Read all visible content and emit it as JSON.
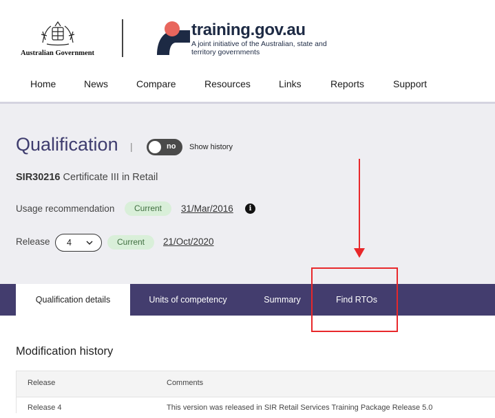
{
  "header": {
    "gov_logo_text": "Australian Government",
    "site_title": "training.gov.au",
    "site_subtitle": "A joint initiative of the Australian, state and territory governments"
  },
  "nav": {
    "items": [
      "Home",
      "News",
      "Compare",
      "Resources",
      "Links",
      "Reports",
      "Support"
    ]
  },
  "qualification": {
    "heading": "Qualification",
    "separator": "|",
    "toggle_label": "no",
    "show_history_label": "Show history",
    "code": "SIR30216",
    "name": "Certificate III in Retail",
    "usage_label": "Usage recommendation",
    "usage_status": "Current",
    "usage_date": "31/Mar/2016",
    "release_label": "Release",
    "release_value": "4",
    "release_status": "Current",
    "release_date": "21/Oct/2020"
  },
  "tabs": [
    "Qualification details",
    "Units of competency",
    "Summary",
    "Find RTOs"
  ],
  "modification_history": {
    "title": "Modification history",
    "columns": [
      "Release",
      "Comments"
    ],
    "rows": [
      {
        "release": "Release 4",
        "comments": "This version was released in SIR Retail Services Training Package Release 5.0"
      }
    ]
  },
  "colors": {
    "brand": "#433d6e",
    "accent": "#e8665d",
    "annotation": "#e8272a",
    "badge_bg": "#d9efd9"
  }
}
